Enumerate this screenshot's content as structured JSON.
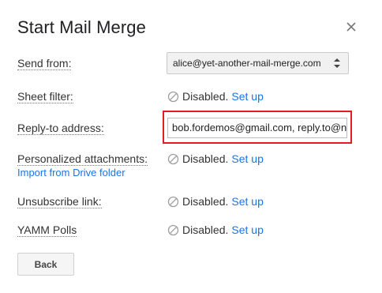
{
  "dialog": {
    "title": "Start Mail Merge",
    "close_icon": "close-icon"
  },
  "rows": {
    "send_from": {
      "label": "Send from:",
      "value": "alice@yet-another-mail-merge.com",
      "icon": "select-arrows-icon"
    },
    "sheet_filter": {
      "label": "Sheet filter:",
      "status": "Disabled.",
      "link": "Set up",
      "icon": "disabled-icon"
    },
    "reply_to": {
      "label": "Reply-to address:",
      "value": "bob.fordemos@gmail.com, reply.to@n"
    },
    "attachments": {
      "label": "Personalized attachments:",
      "import_link": "Import from Drive folder",
      "status": "Disabled.",
      "link": "Set up",
      "icon": "disabled-icon"
    },
    "unsubscribe": {
      "label": "Unsubscribe link:",
      "status": "Disabled.",
      "link": "Set up",
      "icon": "disabled-icon"
    },
    "polls": {
      "label": "YAMM Polls",
      "status": "Disabled.",
      "link": "Set up",
      "icon": "disabled-icon"
    }
  },
  "footer": {
    "back_label": "Back"
  },
  "colors": {
    "link": "#1a73e8",
    "highlight": "#e02020"
  }
}
